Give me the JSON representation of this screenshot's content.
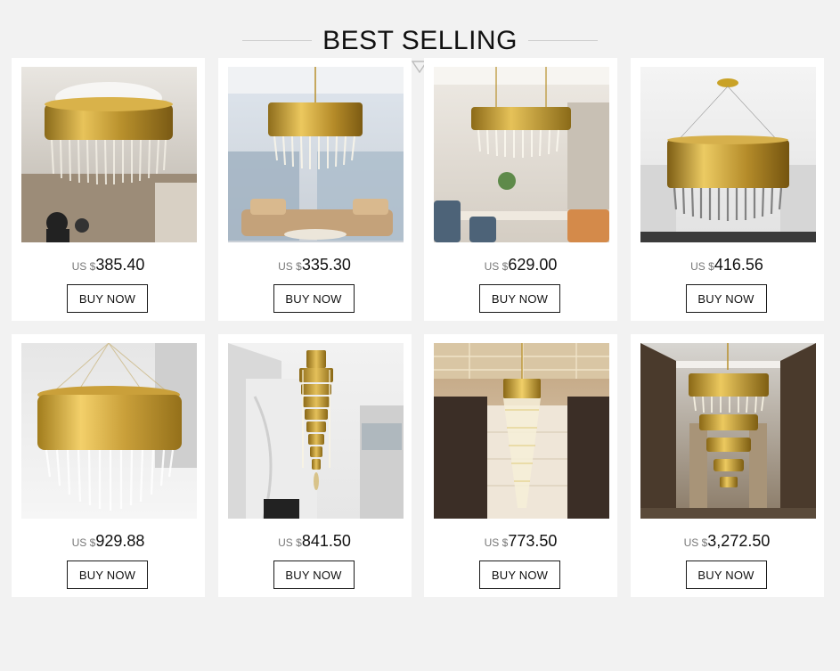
{
  "header": {
    "title": "BEST SELLING"
  },
  "products": [
    {
      "currency": "US $",
      "price": "385.40",
      "button": "BUY NOW"
    },
    {
      "currency": "US $",
      "price": "335.30",
      "button": "BUY NOW"
    },
    {
      "currency": "US $",
      "price": "629.00",
      "button": "BUY NOW"
    },
    {
      "currency": "US $",
      "price": "416.56",
      "button": "BUY NOW"
    },
    {
      "currency": "US $",
      "price": "929.88",
      "button": "BUY NOW"
    },
    {
      "currency": "US $",
      "price": "841.50",
      "button": "BUY NOW"
    },
    {
      "currency": "US $",
      "price": "773.50",
      "button": "BUY NOW"
    },
    {
      "currency": "US $",
      "price": "3,272.50",
      "button": "BUY NOW"
    }
  ],
  "colors": {
    "background": "#f2f2f2",
    "card": "#ffffff",
    "gold": "#c9a227",
    "text": "#111111"
  }
}
